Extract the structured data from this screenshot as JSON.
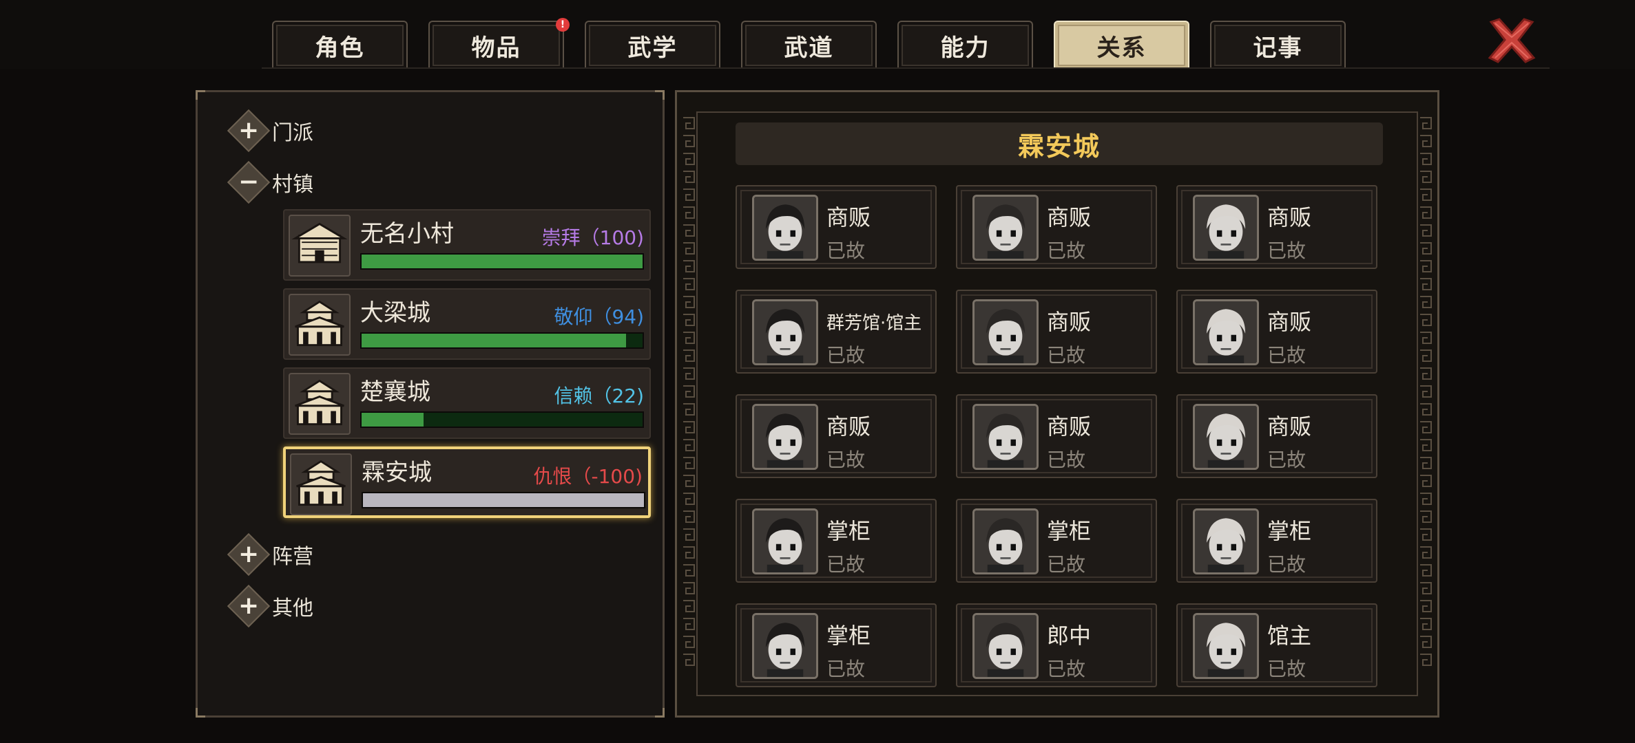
{
  "tabs": [
    {
      "label": "角色",
      "active": false,
      "alert": false
    },
    {
      "label": "物品",
      "active": false,
      "alert": true
    },
    {
      "label": "武学",
      "active": false,
      "alert": false
    },
    {
      "label": "武道",
      "active": false,
      "alert": false
    },
    {
      "label": "能力",
      "active": false,
      "alert": false
    },
    {
      "label": "关系",
      "active": true,
      "alert": false
    },
    {
      "label": "记事",
      "active": false,
      "alert": false
    }
  ],
  "alert_glyph": "!",
  "categories": {
    "sect": {
      "label": "门派",
      "toggle": "+"
    },
    "village": {
      "label": "村镇",
      "toggle": "−"
    },
    "camp": {
      "label": "阵营",
      "toggle": "+"
    },
    "other": {
      "label": "其他",
      "toggle": "+"
    }
  },
  "towns": [
    {
      "name": "无名小村",
      "relation": "崇拜（100)",
      "relation_color": "#b67be6",
      "level": 1.0,
      "selected": false,
      "icon": "village-house-icon"
    },
    {
      "name": "大梁城",
      "relation": "敬仰（94)",
      "relation_color": "#3f8fe0",
      "level": 0.94,
      "selected": false,
      "icon": "city-gate-icon"
    },
    {
      "name": "楚襄城",
      "relation": "信赖（22)",
      "relation_color": "#52c3e6",
      "level": 0.22,
      "selected": false,
      "icon": "city-gate-icon"
    },
    {
      "name": "霖安城",
      "relation": "仇恨（-100)",
      "relation_color": "#e54a4a",
      "level": 0.0,
      "selected": true,
      "icon": "city-gate-icon"
    }
  ],
  "detail": {
    "title": "霖安城",
    "npcs": [
      {
        "role": "商贩",
        "status": "已故"
      },
      {
        "role": "商贩",
        "status": "已故"
      },
      {
        "role": "商贩",
        "status": "已故"
      },
      {
        "role": "群芳馆·馆主",
        "status": "已故"
      },
      {
        "role": "商贩",
        "status": "已故"
      },
      {
        "role": "商贩",
        "status": "已故"
      },
      {
        "role": "商贩",
        "status": "已故"
      },
      {
        "role": "商贩",
        "status": "已故"
      },
      {
        "role": "商贩",
        "status": "已故"
      },
      {
        "role": "掌柜",
        "status": "已故"
      },
      {
        "role": "掌柜",
        "status": "已故"
      },
      {
        "role": "掌柜",
        "status": "已故"
      },
      {
        "role": "掌柜",
        "status": "已故"
      },
      {
        "role": "郎中",
        "status": "已故"
      },
      {
        "role": "馆主",
        "status": "已故"
      }
    ]
  },
  "colors": {
    "active_tab": "#d8c9a2",
    "title_gold": "#f3c95a",
    "bar_green": "#3e9b43",
    "close_red": "#c8413a",
    "selected_border": "#f0d27a"
  },
  "icons": {
    "close": "close-x-icon",
    "expand": "plus-icon",
    "collapse": "minus-icon",
    "portrait": "npc-portrait"
  }
}
